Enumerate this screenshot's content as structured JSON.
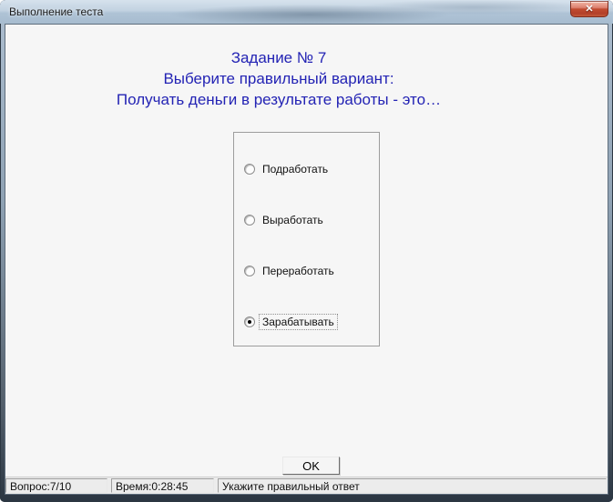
{
  "window": {
    "title": "Выполнение теста"
  },
  "icons": {
    "close": "✕"
  },
  "question": {
    "line1": "Задание № 7",
    "line2": "Выберите правильный вариант:",
    "line3": "Получать деньги в результате работы - это…"
  },
  "options": [
    {
      "label": "Подработать",
      "selected": false
    },
    {
      "label": "Выработать",
      "selected": false
    },
    {
      "label": "Переработать",
      "selected": false
    },
    {
      "label": "Зарабатывать",
      "selected": true
    }
  ],
  "ok_button": "OK",
  "status_bar": {
    "question_counter": "Вопрос:7/10",
    "time": "Время:0:28:45",
    "hint": "Укажите правильный ответ"
  },
  "colors": {
    "heading_blue": "#2323b4",
    "close_red": "#c04b30",
    "client_bg": "#f6f6f6",
    "statusbar_bg": "#ececec"
  }
}
